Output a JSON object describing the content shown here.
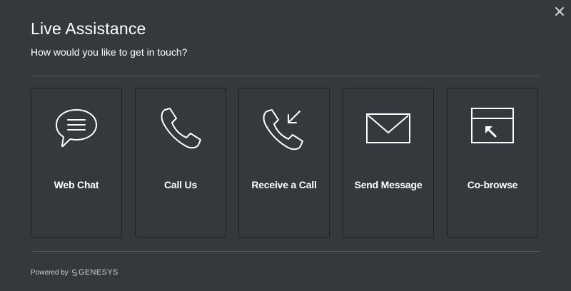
{
  "dialog": {
    "title": "Live Assistance",
    "subtitle": "How would you like to get in touch?",
    "close_icon": "close-icon"
  },
  "options": [
    {
      "label": "Web Chat",
      "icon": "chat-bubble-icon"
    },
    {
      "label": "Call Us",
      "icon": "phone-icon"
    },
    {
      "label": "Receive a Call",
      "icon": "incoming-call-icon"
    },
    {
      "label": "Send Message",
      "icon": "envelope-icon"
    },
    {
      "label": "Co-browse",
      "icon": "cobrowse-window-icon"
    }
  ],
  "footer": {
    "powered_by": "Powered by",
    "brand": "GENESYS"
  },
  "colors": {
    "background": "#35393d",
    "border": "#1f2225",
    "divider": "#50555a",
    "text": "#ffffff",
    "footer_text": "#c9cdd1"
  }
}
